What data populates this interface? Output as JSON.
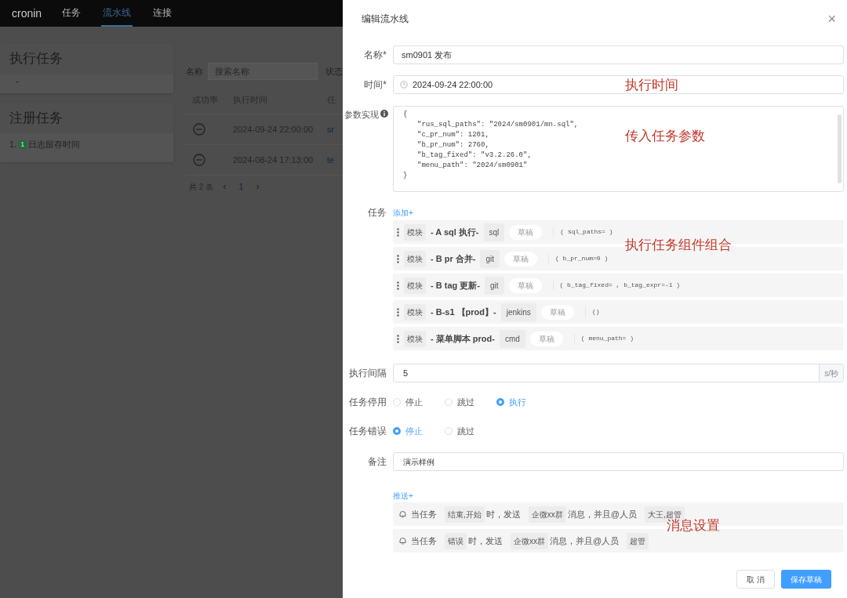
{
  "nav": {
    "brand": "cronin",
    "items": [
      {
        "label": "任务",
        "selected": false
      },
      {
        "label": "流水线",
        "selected": true
      },
      {
        "label": "连接",
        "selected": false
      }
    ]
  },
  "exec_card": {
    "title": "执行任务",
    "items": [
      "-"
    ]
  },
  "register_card": {
    "title": "注册任务",
    "items": [
      {
        "index": "1.",
        "badge": "1",
        "label": "日志留存时间"
      }
    ]
  },
  "list": {
    "filter_label": "名称",
    "filter_placeholder": "搜索名称",
    "status_label": "状态",
    "columns": [
      "成功率",
      "执行时间",
      "任"
    ],
    "rows": [
      {
        "time": "2024-09-24 22:00:00",
        "name": "sr"
      },
      {
        "time": "2024-08-24 17:13:00",
        "name": "te"
      }
    ],
    "total": "共 2 条",
    "prev": "‹",
    "page": "1",
    "next": "›"
  },
  "drawer": {
    "title": "编辑流水线",
    "close": "×",
    "name_label": "名称*",
    "name_value": "sm0901 发布",
    "time_label": "时间*",
    "time_value": "2024-09-24 22:00:00",
    "params_label": "参数实现",
    "params_lines": [
      "{",
      "\"rus_sql_paths\": \"2024/sm0901/mn.sql\",",
      "\"c_pr_num\": 1201,",
      "\"b_pr_num\": 2760,",
      "\"b_tag_fixed\": \"v3.2.26.0\",",
      "\"menu_path\": \"2024/sm0901\"",
      "}"
    ],
    "tasks_label": "任务",
    "tasks_add": "添加+",
    "tasks": [
      {
        "module": "模块",
        "name": "- A sql 执行-",
        "type": "sql",
        "status": "草稿",
        "params": "( sql_paths= )"
      },
      {
        "module": "模块",
        "name": "- B pr 合并-",
        "type": "git",
        "status": "草稿",
        "params": "( b_pr_num=0 )"
      },
      {
        "module": "模块",
        "name": "- B tag 更新-",
        "type": "git",
        "status": "草稿",
        "params": "( b_tag_fixed= , b_tag_expr=-1 )"
      },
      {
        "module": "模块",
        "name": "- B-s1 【prod】-",
        "type": "jenkins",
        "status": "草稿",
        "params": "()"
      },
      {
        "module": "模块",
        "name": "- 菜单脚本 prod-",
        "type": "cmd",
        "status": "草稿",
        "params": "( menu_path= )"
      }
    ],
    "interval_label": "执行间隔",
    "interval_value": "5",
    "interval_unit": "s/秒",
    "radio_groups": [
      {
        "label": "任务停用",
        "options": [
          {
            "label": "停止",
            "selected": false
          },
          {
            "label": "跳过",
            "selected": false
          },
          {
            "label": "执行",
            "selected": true
          }
        ]
      },
      {
        "label": "任务错误",
        "options": [
          {
            "label": "停止",
            "selected": true
          },
          {
            "label": "跳过",
            "selected": false
          }
        ]
      }
    ],
    "remark_label": "备注",
    "remark_value": "演示样例",
    "push_add": "推送+",
    "messages": [
      [
        {
          "kind": "text",
          "text": "当任务"
        },
        {
          "kind": "tag",
          "text": "结束,开始"
        },
        {
          "kind": "text",
          "text": "时，发送"
        },
        {
          "kind": "tag",
          "text": "企微xx群"
        },
        {
          "kind": "text",
          "text": "消息，并且@人员"
        },
        {
          "kind": "tag",
          "text": "大王,超管"
        }
      ],
      [
        {
          "kind": "text",
          "text": "当任务"
        },
        {
          "kind": "tag",
          "text": "错误"
        },
        {
          "kind": "text",
          "text": "时，发送"
        },
        {
          "kind": "tag",
          "text": "企微xx群"
        },
        {
          "kind": "text",
          "text": "消息，并且@人员"
        },
        {
          "kind": "tag",
          "text": "超管"
        }
      ]
    ],
    "cancel": "取 消",
    "save": "保存草稿"
  },
  "annotations": [
    "执行时间",
    "传入任务参数",
    "执行任务组件组合",
    "消息设置"
  ]
}
